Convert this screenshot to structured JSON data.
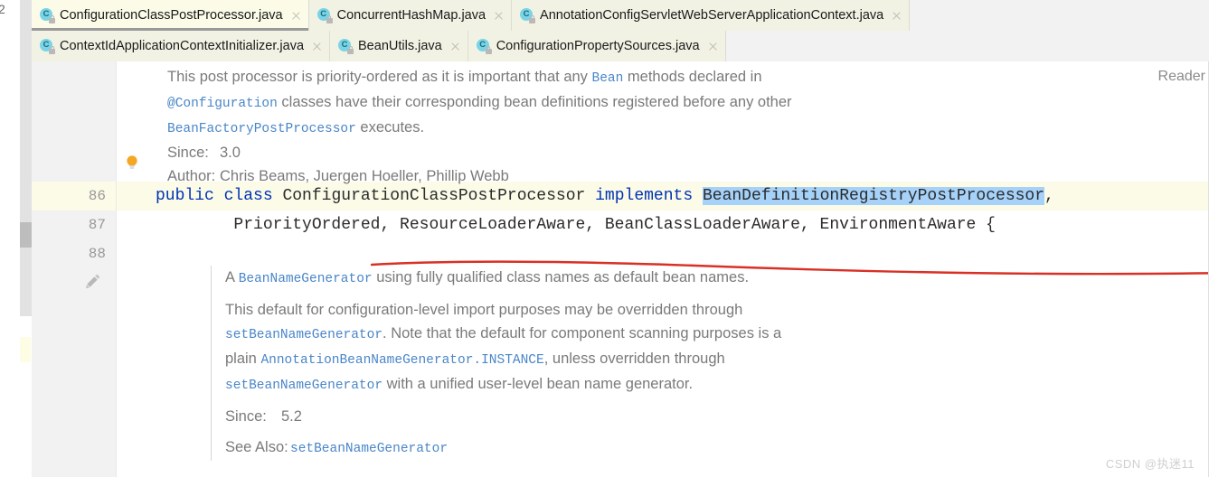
{
  "window": {
    "left_rail_clip_text": "2",
    "watermark": "CSDN @执迷11"
  },
  "tabs": {
    "row1": [
      {
        "label": "ConfigurationClassPostProcessor.java",
        "icon": "java-class-icon",
        "active": true,
        "close_icon": "close-icon"
      },
      {
        "label": "ConcurrentHashMap.java",
        "icon": "java-class-icon",
        "active": false,
        "close_icon": "close-icon"
      },
      {
        "label": "AnnotationConfigServletWebServerApplicationContext.java",
        "icon": "java-class-icon",
        "active": false,
        "close_icon": "close-icon"
      }
    ],
    "row2": [
      {
        "label": "ContextIdApplicationContextInitializer.java",
        "icon": "java-class-icon",
        "active": false,
        "close_icon": "close-icon"
      },
      {
        "label": "BeanUtils.java",
        "icon": "java-class-icon",
        "active": false,
        "close_icon": "close-icon"
      },
      {
        "label": "ConfigurationPropertySources.java",
        "icon": "java-class-icon",
        "active": false,
        "close_icon": "close-icon"
      }
    ]
  },
  "editor": {
    "reader_label": "Reader",
    "gutter": {
      "line_numbers": [
        "86",
        "87",
        "88"
      ],
      "edit_icon": "pencil-icon"
    },
    "bulb_icon": "lightbulb-icon",
    "doc_top": {
      "paragraph_parts": [
        {
          "text": "This post processor is priority-ordered as it is important that any ",
          "style": "plain"
        },
        {
          "text": "Bean",
          "style": "code-link"
        },
        {
          "text": " methods declared in ",
          "style": "plain"
        },
        {
          "text": "@Configuration",
          "style": "code"
        },
        {
          "text": " classes have their corresponding bean definitions registered before any other ",
          "style": "plain"
        },
        {
          "text": "BeanFactoryPostProcessor",
          "style": "code-link"
        },
        {
          "text": " executes.",
          "style": "plain"
        }
      ],
      "since_key": "Since:",
      "since_value": "3.0",
      "author_key": "Author:",
      "author_value": "Chris Beams, Juergen Hoeller, Phillip Webb"
    },
    "code": {
      "line1": {
        "kw_public": "public",
        "kw_class": "class",
        "class_name": "ConfigurationClassPostProcessor",
        "kw_implements": "implements",
        "selected_type": "BeanDefinitionRegistryPostProcessor",
        "trailing_comma": ","
      },
      "line2": "        PriorityOrdered, ResourceLoaderAware, BeanClassLoaderAware, EnvironmentAware {",
      "selection_color": "#a6d2fa",
      "keyword_color": "#0033b3",
      "caret_line_color": "#fbfbe8",
      "annotation_color": "#d93025"
    },
    "doc_lower": {
      "p1_parts": [
        {
          "text": "A ",
          "style": "plain"
        },
        {
          "text": "BeanNameGenerator",
          "style": "code"
        },
        {
          "text": " using fully qualified class names as default bean names.",
          "style": "plain"
        }
      ],
      "p2_parts": [
        {
          "text": "This default for configuration-level import purposes may be overridden through ",
          "style": "plain"
        },
        {
          "text": "setBeanNameGenerator",
          "style": "code-link"
        },
        {
          "text": ". Note that the default for component scanning purposes is a plain ",
          "style": "plain"
        },
        {
          "text": "AnnotationBeanNameGenerator.INSTANCE",
          "style": "code"
        },
        {
          "text": ", unless overridden through ",
          "style": "plain"
        },
        {
          "text": "setBeanNameGenerator",
          "style": "code-link"
        },
        {
          "text": " with a unified user-level bean name generator.",
          "style": "plain"
        }
      ],
      "since_key": "Since:",
      "since_value": "5.2",
      "see_also_key": "See Also:",
      "see_also_value": "setBeanNameGenerator"
    }
  }
}
